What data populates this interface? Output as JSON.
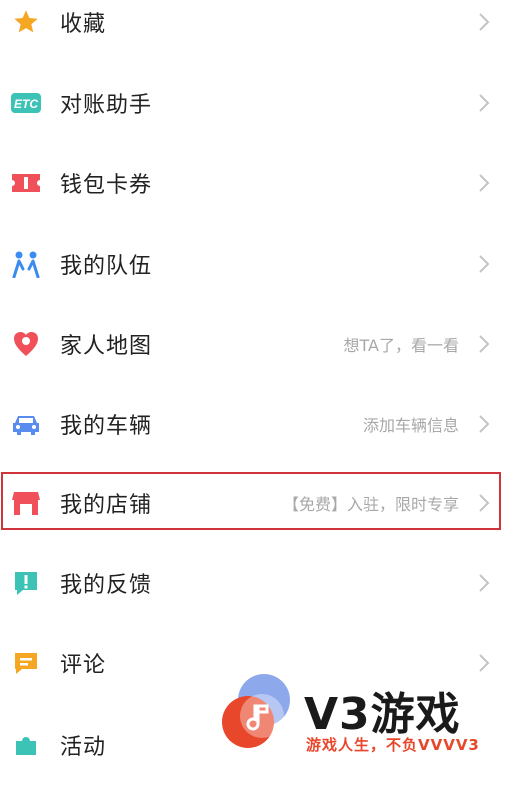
{
  "menu": {
    "items": [
      {
        "label": "收藏",
        "hint": ""
      },
      {
        "label": "对账助手",
        "hint": ""
      },
      {
        "label": "钱包卡券",
        "hint": ""
      },
      {
        "label": "我的队伍",
        "hint": ""
      },
      {
        "label": "家人地图",
        "hint": "想TA了，看一看"
      },
      {
        "label": "我的车辆",
        "hint": "添加车辆信息"
      },
      {
        "label": "我的店铺",
        "hint": "【免费】入驻，限时专享"
      },
      {
        "label": "我的反馈",
        "hint": ""
      },
      {
        "label": "评论",
        "hint": ""
      },
      {
        "label": "活动",
        "hint": ""
      }
    ],
    "etc_text": "ETC"
  },
  "watermark": {
    "logo_text": "V3游戏",
    "slogan": "游戏人生，不负VVVV3"
  },
  "colors": {
    "star": "#f5a623",
    "etc": "#3cc3b5",
    "ticket": "#f0505a",
    "team": "#3b8cf0",
    "family": "#f0505a",
    "car": "#5a8cf0",
    "store": "#f0505a",
    "feedback": "#3cc3b5",
    "comment": "#f5a623",
    "highlight": "#d0343b"
  }
}
